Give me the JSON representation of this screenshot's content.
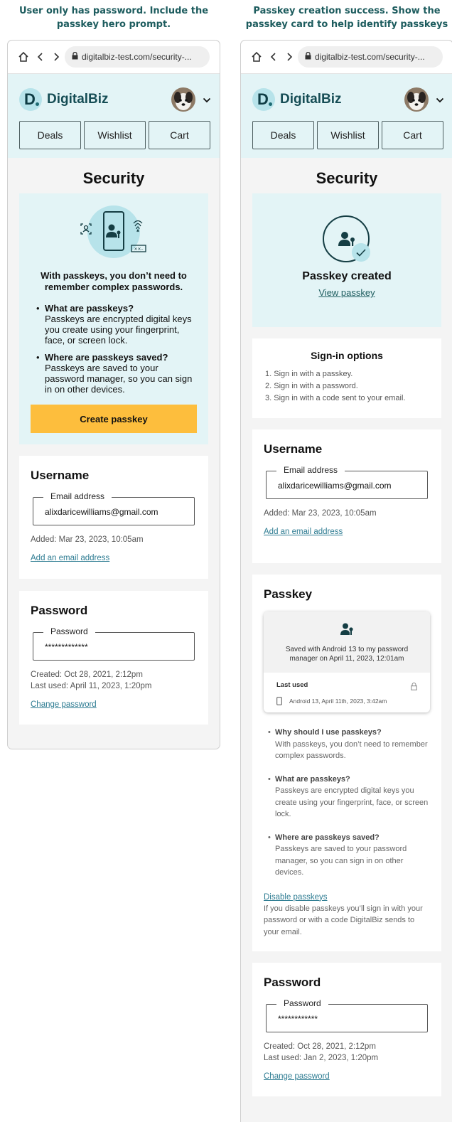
{
  "captions": {
    "left": "User only has password. Include the passkey hero prompt.",
    "right": "Passkey creation success. Show the passkey card to help identify passkeys"
  },
  "browser": {
    "url": "digitalbiz-test.com/security-..."
  },
  "site": {
    "brand": "DigitalBiz",
    "tabs": [
      "Deals",
      "Wishlist",
      "Cart"
    ]
  },
  "page": {
    "title": "Security"
  },
  "left": {
    "hero": {
      "lead": "With passkeys, you don’t need to remember complex passwords.",
      "items": [
        {
          "q": "What are passkeys?",
          "a": "Passkeys are encrypted digital keys you create using your fingerprint, face, or screen lock."
        },
        {
          "q": "Where are passkeys saved?",
          "a": "Passkeys are saved to your password manager, so you can sign in on other devices."
        }
      ],
      "button": "Create passkey"
    },
    "username": {
      "title": "Username",
      "field_label": "Email address",
      "email": "alixdaricewilliams@gmail.com",
      "added": "Added: Mar 23, 2023, 10:05am",
      "link": "Add an email address"
    },
    "password": {
      "title": "Password",
      "field_label": "Password",
      "value": "*************",
      "created": "Created: Oct 28, 2021, 2:12pm",
      "last_used": "Last used: April 11, 2023, 1:20pm",
      "link": "Change password"
    }
  },
  "right": {
    "success": {
      "title": "Passkey created",
      "link": "View passkey"
    },
    "signin": {
      "title": "Sign-in options",
      "items": [
        "1. Sign in with a passkey.",
        "2. Sign in with a password.",
        "3. Sign in with a code sent to your email."
      ]
    },
    "username": {
      "title": "Username",
      "field_label": "Email address",
      "email": "alixdaricewilliams@gmail.com",
      "added": "Added: Mar 23, 2023, 10:05am",
      "link": "Add an email address"
    },
    "passkey": {
      "title": "Passkey",
      "saved": "Saved with Android 13 to my password manager on April 11, 2023, 12:01am",
      "last_used_label": "Last used",
      "device": "Android 13, April 11th, 2023, 3:42am",
      "items": [
        {
          "q": "Why should I use passkeys?",
          "a": "With passkeys, you don’t need to remember complex passwords."
        },
        {
          "q": "What are passkeys?",
          "a": "Passkeys are encrypted digital keys you create using your fingerprint, face, or screen lock."
        },
        {
          "q": "Where are passkeys saved?",
          "a": "Passkeys are saved to your password manager, so you can sign in on other devices."
        }
      ],
      "disable_link": "Disable passkeys",
      "disable_note": "If you disable passkeys you’ll sign in with your password or with a code DigitalBiz sends to your email."
    },
    "password": {
      "title": "Password",
      "field_label": "Password",
      "value": "************",
      "created": "Created: Oct 28, 2021, 2:12pm",
      "last_used": "Last used: Jan 2, 2023, 1:20pm",
      "link": "Change password"
    }
  },
  "colors": {
    "accent": "#1d5c5e",
    "header_bg": "#e3f4f6",
    "cta": "#fdbe3d",
    "link": "#2e7c92"
  },
  "icons": [
    "home-icon",
    "back-icon",
    "forward-icon",
    "lock-icon",
    "chevron-down-icon",
    "passkey-user-icon",
    "fingerprint-icon",
    "face-id-icon",
    "checkmark-icon",
    "phone-icon"
  ]
}
